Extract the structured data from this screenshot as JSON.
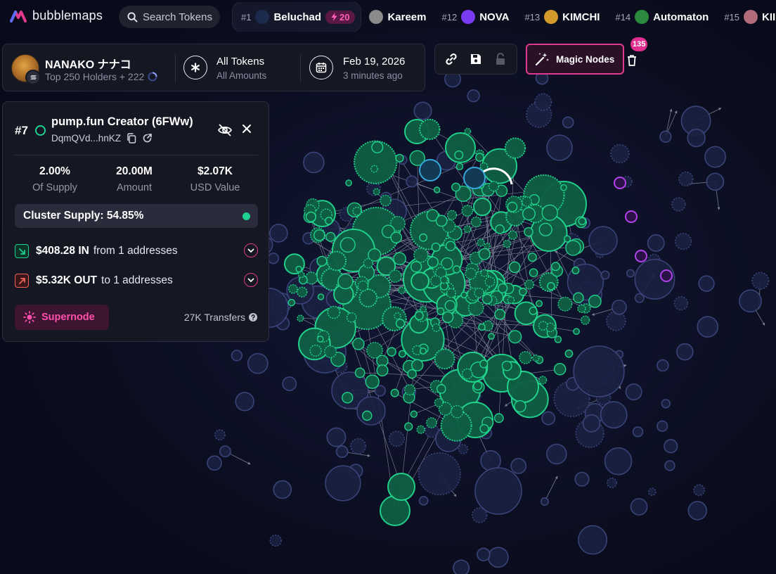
{
  "app": {
    "name": "bubblemaps"
  },
  "search": {
    "placeholder": "Search Tokens"
  },
  "ticker": [
    {
      "rank": "#1",
      "name": "Beluchad",
      "badge": "20",
      "icon_color": "#1b2a4d",
      "active": true
    },
    {
      "rank": "",
      "name": "Kareem",
      "badge": "",
      "icon_color": "#8a8a8a",
      "active": false
    },
    {
      "rank": "#12",
      "name": "NOVA",
      "badge": "",
      "icon_color": "#7a3cf0",
      "active": false
    },
    {
      "rank": "#13",
      "name": "KIMCHI",
      "badge": "",
      "icon_color": "#d19a2a",
      "active": false
    },
    {
      "rank": "#14",
      "name": "Automaton",
      "badge": "",
      "icon_color": "#2c8a3e",
      "active": false
    },
    {
      "rank": "#15",
      "name": "KII",
      "badge": "",
      "icon_color": "#b06a7a",
      "active": false
    }
  ],
  "holders": {
    "token_name": "NANAKO ナナコ",
    "subtitle": "Top 250 Holders + 222",
    "filter_title": "All Tokens",
    "filter_sub": "All Amounts",
    "date": "Feb 19, 2026",
    "date_ago": "3 minutes ago"
  },
  "toolbar": {
    "link_icon": "link-icon",
    "save_icon": "save-icon",
    "lock_icon": "lock-icon",
    "magic_label": "Magic Nodes",
    "magic_count": "135"
  },
  "node": {
    "rank": "#7",
    "title": "pump.fun Creator (6FWw)",
    "address": "DqmQVd...hnKZ",
    "stats": [
      {
        "value": "2.00%",
        "label": "Of Supply"
      },
      {
        "value": "20.00M",
        "label": "Amount"
      },
      {
        "value": "$2.07K",
        "label": "USD Value"
      }
    ],
    "cluster_supply": "Cluster Supply: 54.85%",
    "in": {
      "amount": "$408.28 IN",
      "text": "from 1 addresses"
    },
    "out": {
      "amount": "$5.32K OUT",
      "text": "to 1 addresses"
    },
    "supernode_label": "Supernode",
    "transfers": "27K Transfers"
  },
  "colors": {
    "background": "#0b0c1c",
    "panel": "#151722",
    "accent_pink": "#e0398f",
    "cluster_green": "#1fd18e",
    "node_blue": "#2f3a66",
    "node_purple": "#b043e8"
  }
}
